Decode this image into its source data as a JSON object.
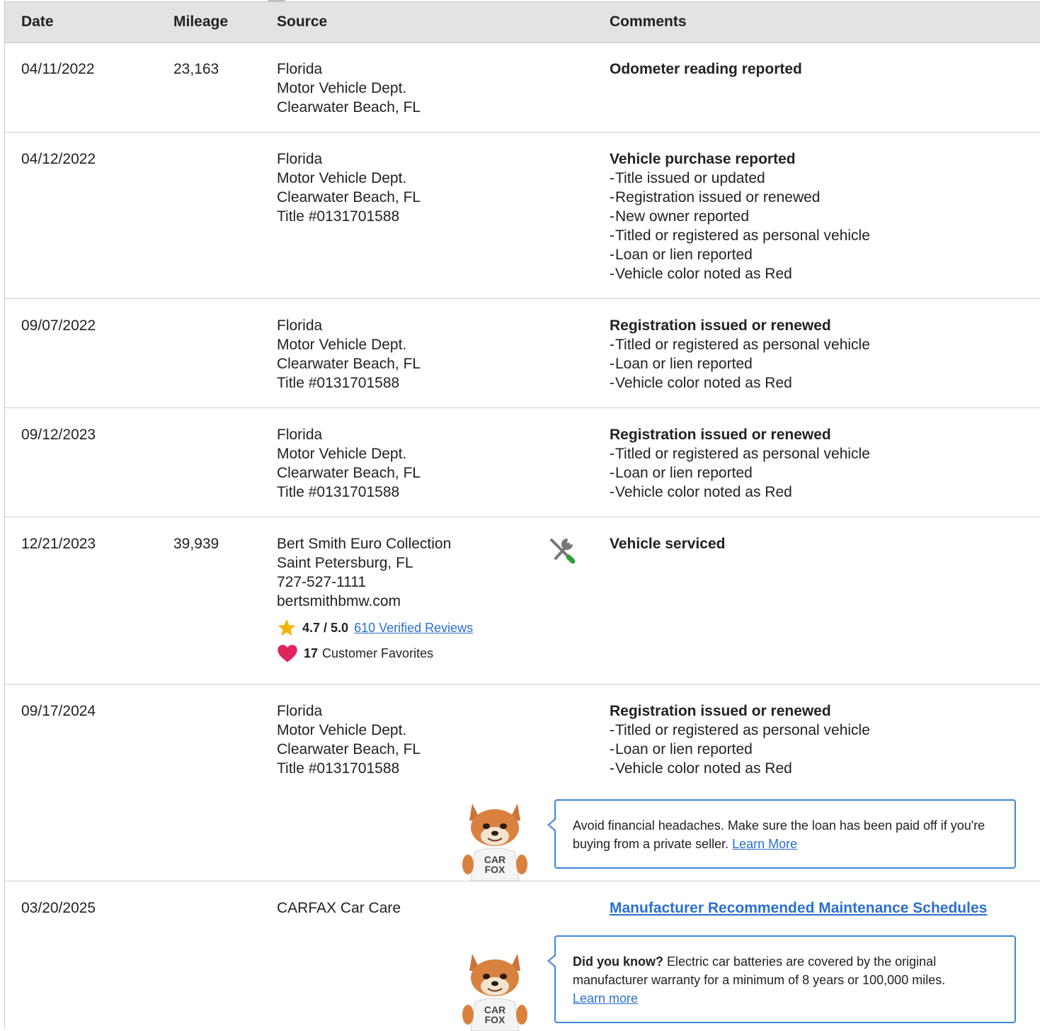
{
  "header": {
    "date": "Date",
    "mileage": "Mileage",
    "source": "Source",
    "comments": "Comments"
  },
  "rows": [
    {
      "date": "04/11/2022",
      "mileage": "23,163",
      "source": [
        "Florida",
        "Motor Vehicle Dept.",
        "Clearwater Beach, FL"
      ],
      "title": "Odometer reading reported",
      "details": []
    },
    {
      "date": "04/12/2022",
      "mileage": "",
      "source": [
        "Florida",
        "Motor Vehicle Dept.",
        "Clearwater Beach, FL",
        "Title #0131701588"
      ],
      "title": "Vehicle purchase reported",
      "details": [
        "Title issued or updated",
        "Registration issued or renewed",
        "New owner reported",
        "Titled or registered as personal vehicle",
        "Loan or lien reported",
        "Vehicle color noted as Red"
      ]
    },
    {
      "date": "09/07/2022",
      "mileage": "",
      "source": [
        "Florida",
        "Motor Vehicle Dept.",
        "Clearwater Beach, FL",
        "Title #0131701588"
      ],
      "title": "Registration issued or renewed",
      "details": [
        "Titled or registered as personal vehicle",
        "Loan or lien reported",
        "Vehicle color noted as Red"
      ]
    },
    {
      "date": "09/12/2023",
      "mileage": "",
      "source": [
        "Florida",
        "Motor Vehicle Dept.",
        "Clearwater Beach, FL",
        "Title #0131701588"
      ],
      "title": "Registration issued or renewed",
      "details": [
        "Titled or registered as personal vehicle",
        "Loan or lien reported",
        "Vehicle color noted as Red"
      ]
    },
    {
      "date": "12/21/2023",
      "mileage": "39,939",
      "source": [
        "Bert Smith Euro Collection",
        "Saint Petersburg, FL",
        "727-527-1111",
        "bertsmithbmw.com"
      ],
      "rating": "4.7 / 5.0",
      "reviews_link": "610 Verified Reviews",
      "favorites_count": "17",
      "favorites_label": "Customer Favorites",
      "icon": "service-wrench-icon",
      "title": "Vehicle serviced",
      "details": []
    },
    {
      "date": "09/17/2024",
      "mileage": "",
      "source": [
        "Florida",
        "Motor Vehicle Dept.",
        "Clearwater Beach, FL",
        "Title #0131701588"
      ],
      "title": "Registration issued or renewed",
      "details": [
        "Titled or registered as personal vehicle",
        "Loan or lien reported",
        "Vehicle color noted as Red"
      ],
      "tip_text": "Avoid financial headaches. Make sure the loan has been paid off if you're buying from a private seller.",
      "tip_link": "Learn More"
    },
    {
      "date": "03/20/2025",
      "mileage": "",
      "source": [
        "CARFAX Car Care"
      ],
      "maintenance_link": "Manufacturer Recommended Maintenance Schedules",
      "tip_bold": "Did you know?",
      "tip_text": "Electric car batteries are covered by the original manufacturer warranty for a minimum of 8 years or 100,000 miles.",
      "tip_link": "Learn more"
    }
  ],
  "fox_shirt": [
    "CAR",
    "FOX"
  ],
  "colors": {
    "header_bg": "#e3e3e3",
    "link": "#2a6fd0",
    "callout_border": "#3f86db",
    "star": "#f5b400",
    "heart": "#e0245e",
    "wrench_green": "#2e9e3e"
  }
}
